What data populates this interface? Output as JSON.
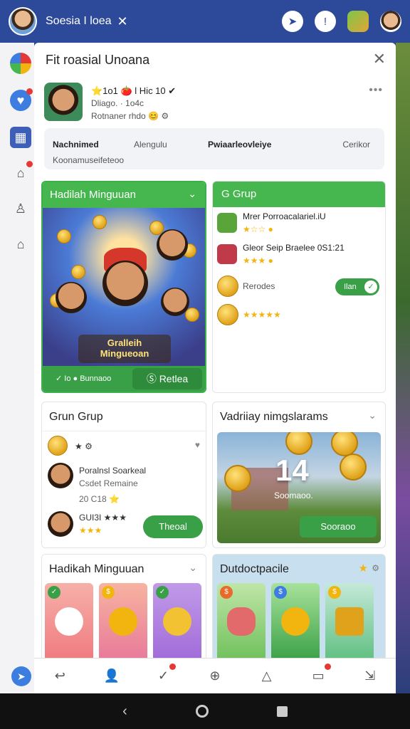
{
  "topbar": {
    "title": "Soesia I loea",
    "close": "✕"
  },
  "panel": {
    "title": "Fit roasial Unoana",
    "close": "✕"
  },
  "profile": {
    "line1": "⭐1o1 🍅 l Hic 10 ✔",
    "line2": "Dliago. · 1o4c",
    "line3": "Rotnaner rhdo 😊 ⚙",
    "more": "•••"
  },
  "stats": {
    "s1": "Nachnimed",
    "s2": "Alengulu",
    "s3": "Pwiaarleovleiye",
    "s4": "Cerikor",
    "s5": "Koonamuseifeteoo"
  },
  "hadiah": {
    "title": "Hadilah Minguuan",
    "chev": "⌄",
    "banner_line1": "Gralleih",
    "banner_line2": "Mingueoan",
    "foot_left": "✓ Io ● Bunnaoo",
    "foot_btn": "Ⓢ Retlea"
  },
  "group": {
    "title": "G Grup",
    "rows": [
      {
        "name": "Mrer Porroacalariel.iU",
        "stars": "★☆☆ ●"
      },
      {
        "name": "Gleor Seip Braelee 0S1:21",
        "stars": "★★★ ●"
      },
      {
        "label": "Rerodes",
        "pill": "Ilan"
      },
      {
        "stars": "★★★★★"
      }
    ]
  },
  "grun": {
    "title": "Grun Grup",
    "chev": "",
    "row1": "★ ⚙",
    "row1_right": "♥",
    "name": "Poralnsl Soarkeal",
    "sub": "Csdet Remaine",
    "meta": "20 C18 ⭐",
    "row3": "GUI3I ★★★",
    "row3b": "★★★",
    "btn": "Theoal"
  },
  "video": {
    "title": "Vadriiay nimgslarams",
    "chev": "⌄",
    "num": "14",
    "sub": "Soomaoo.",
    "btn": "Sooraoo"
  },
  "hadikah": {
    "title": "Hadikah Minguuan",
    "chev": "⌄",
    "badges": [
      "✓",
      "$",
      "✓"
    ]
  },
  "outdo": {
    "title": "Dutdoctpacile",
    "star": "★",
    "more": "⚙",
    "badges": [
      "$",
      "$",
      "$"
    ]
  },
  "colors": {
    "brand": "#2d4a9a",
    "green": "#46b74f",
    "star": "#f2b50f"
  }
}
